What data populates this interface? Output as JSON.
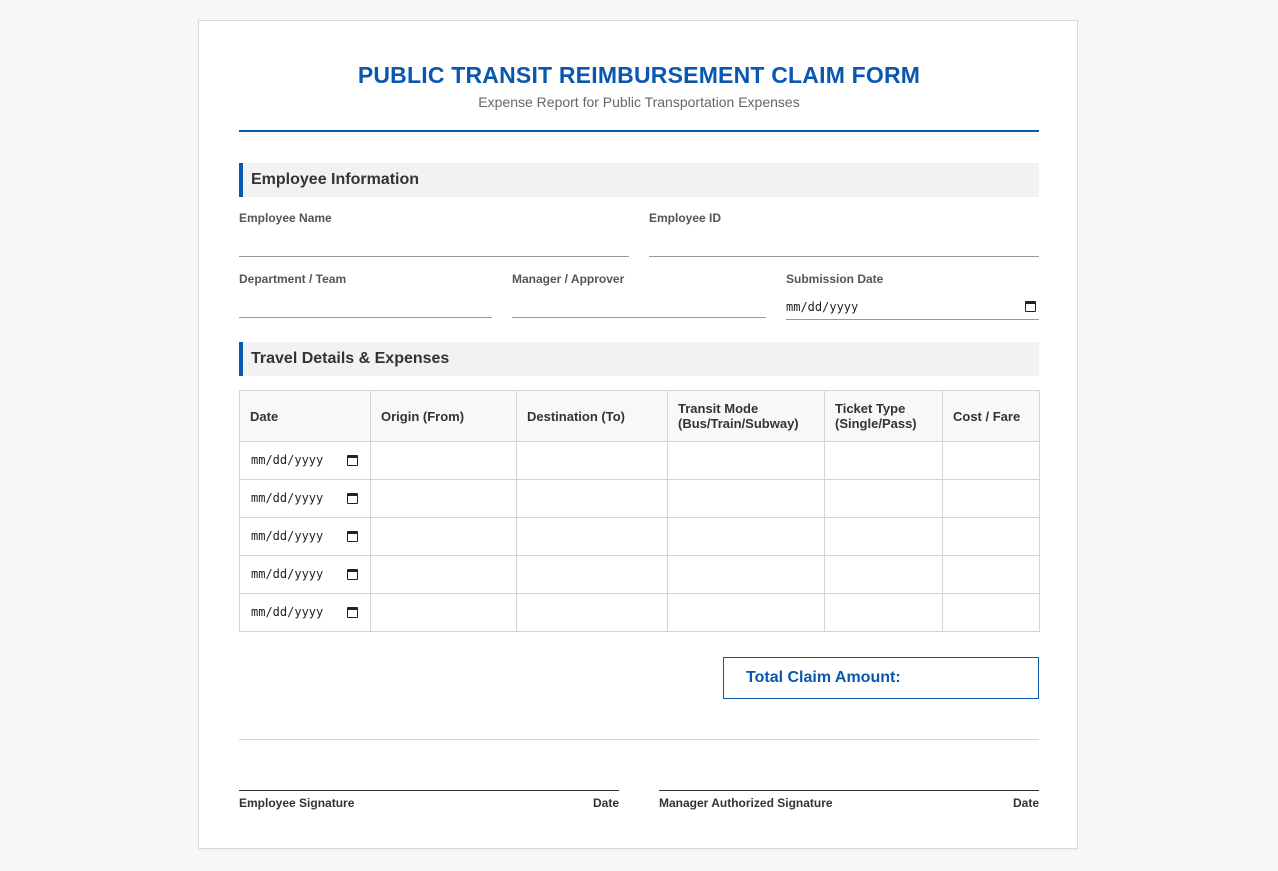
{
  "form": {
    "title": "PUBLIC TRANSIT REIMBURSEMENT CLAIM FORM",
    "subtitle": "Expense Report for Public Transportation Expenses"
  },
  "employee_section": {
    "heading": "Employee Information",
    "fields": {
      "employee_name": {
        "label": "Employee Name",
        "value": ""
      },
      "employee_id": {
        "label": "Employee ID",
        "value": ""
      },
      "department": {
        "label": "Department / Team",
        "value": ""
      },
      "manager": {
        "label": "Manager / Approver",
        "value": ""
      },
      "submission_date": {
        "label": "Submission Date",
        "placeholder": "mm/dd/yyyy"
      }
    }
  },
  "travel_section": {
    "heading": "Travel Details & Expenses",
    "columns": [
      "Date",
      "Origin (From)",
      "Destination (To)",
      "Transit Mode (Bus/Train/Subway)",
      "Ticket Type (Single/Pass)",
      "Cost / Fare"
    ],
    "date_placeholder": "mm/dd/yyyy",
    "rows": [
      {
        "origin": "",
        "destination": "",
        "mode": "",
        "ticket": "",
        "cost": ""
      },
      {
        "origin": "",
        "destination": "",
        "mode": "",
        "ticket": "",
        "cost": ""
      },
      {
        "origin": "",
        "destination": "",
        "mode": "",
        "ticket": "",
        "cost": ""
      },
      {
        "origin": "",
        "destination": "",
        "mode": "",
        "ticket": "",
        "cost": ""
      },
      {
        "origin": "",
        "destination": "",
        "mode": "",
        "ticket": "",
        "cost": ""
      }
    ]
  },
  "total": {
    "label": "Total Claim Amount:",
    "value": ""
  },
  "signatures": {
    "employee": {
      "label": "Employee Signature",
      "date_label": "Date"
    },
    "manager": {
      "label": "Manager Authorized Signature",
      "date_label": "Date"
    }
  },
  "colors": {
    "accent": "#0a57b0",
    "section_bg": "#f2f2f2",
    "table_header_bg": "#f7f8fa",
    "border": "#d5d5d5"
  },
  "icons": {
    "date_picker": "calendar-icon"
  }
}
